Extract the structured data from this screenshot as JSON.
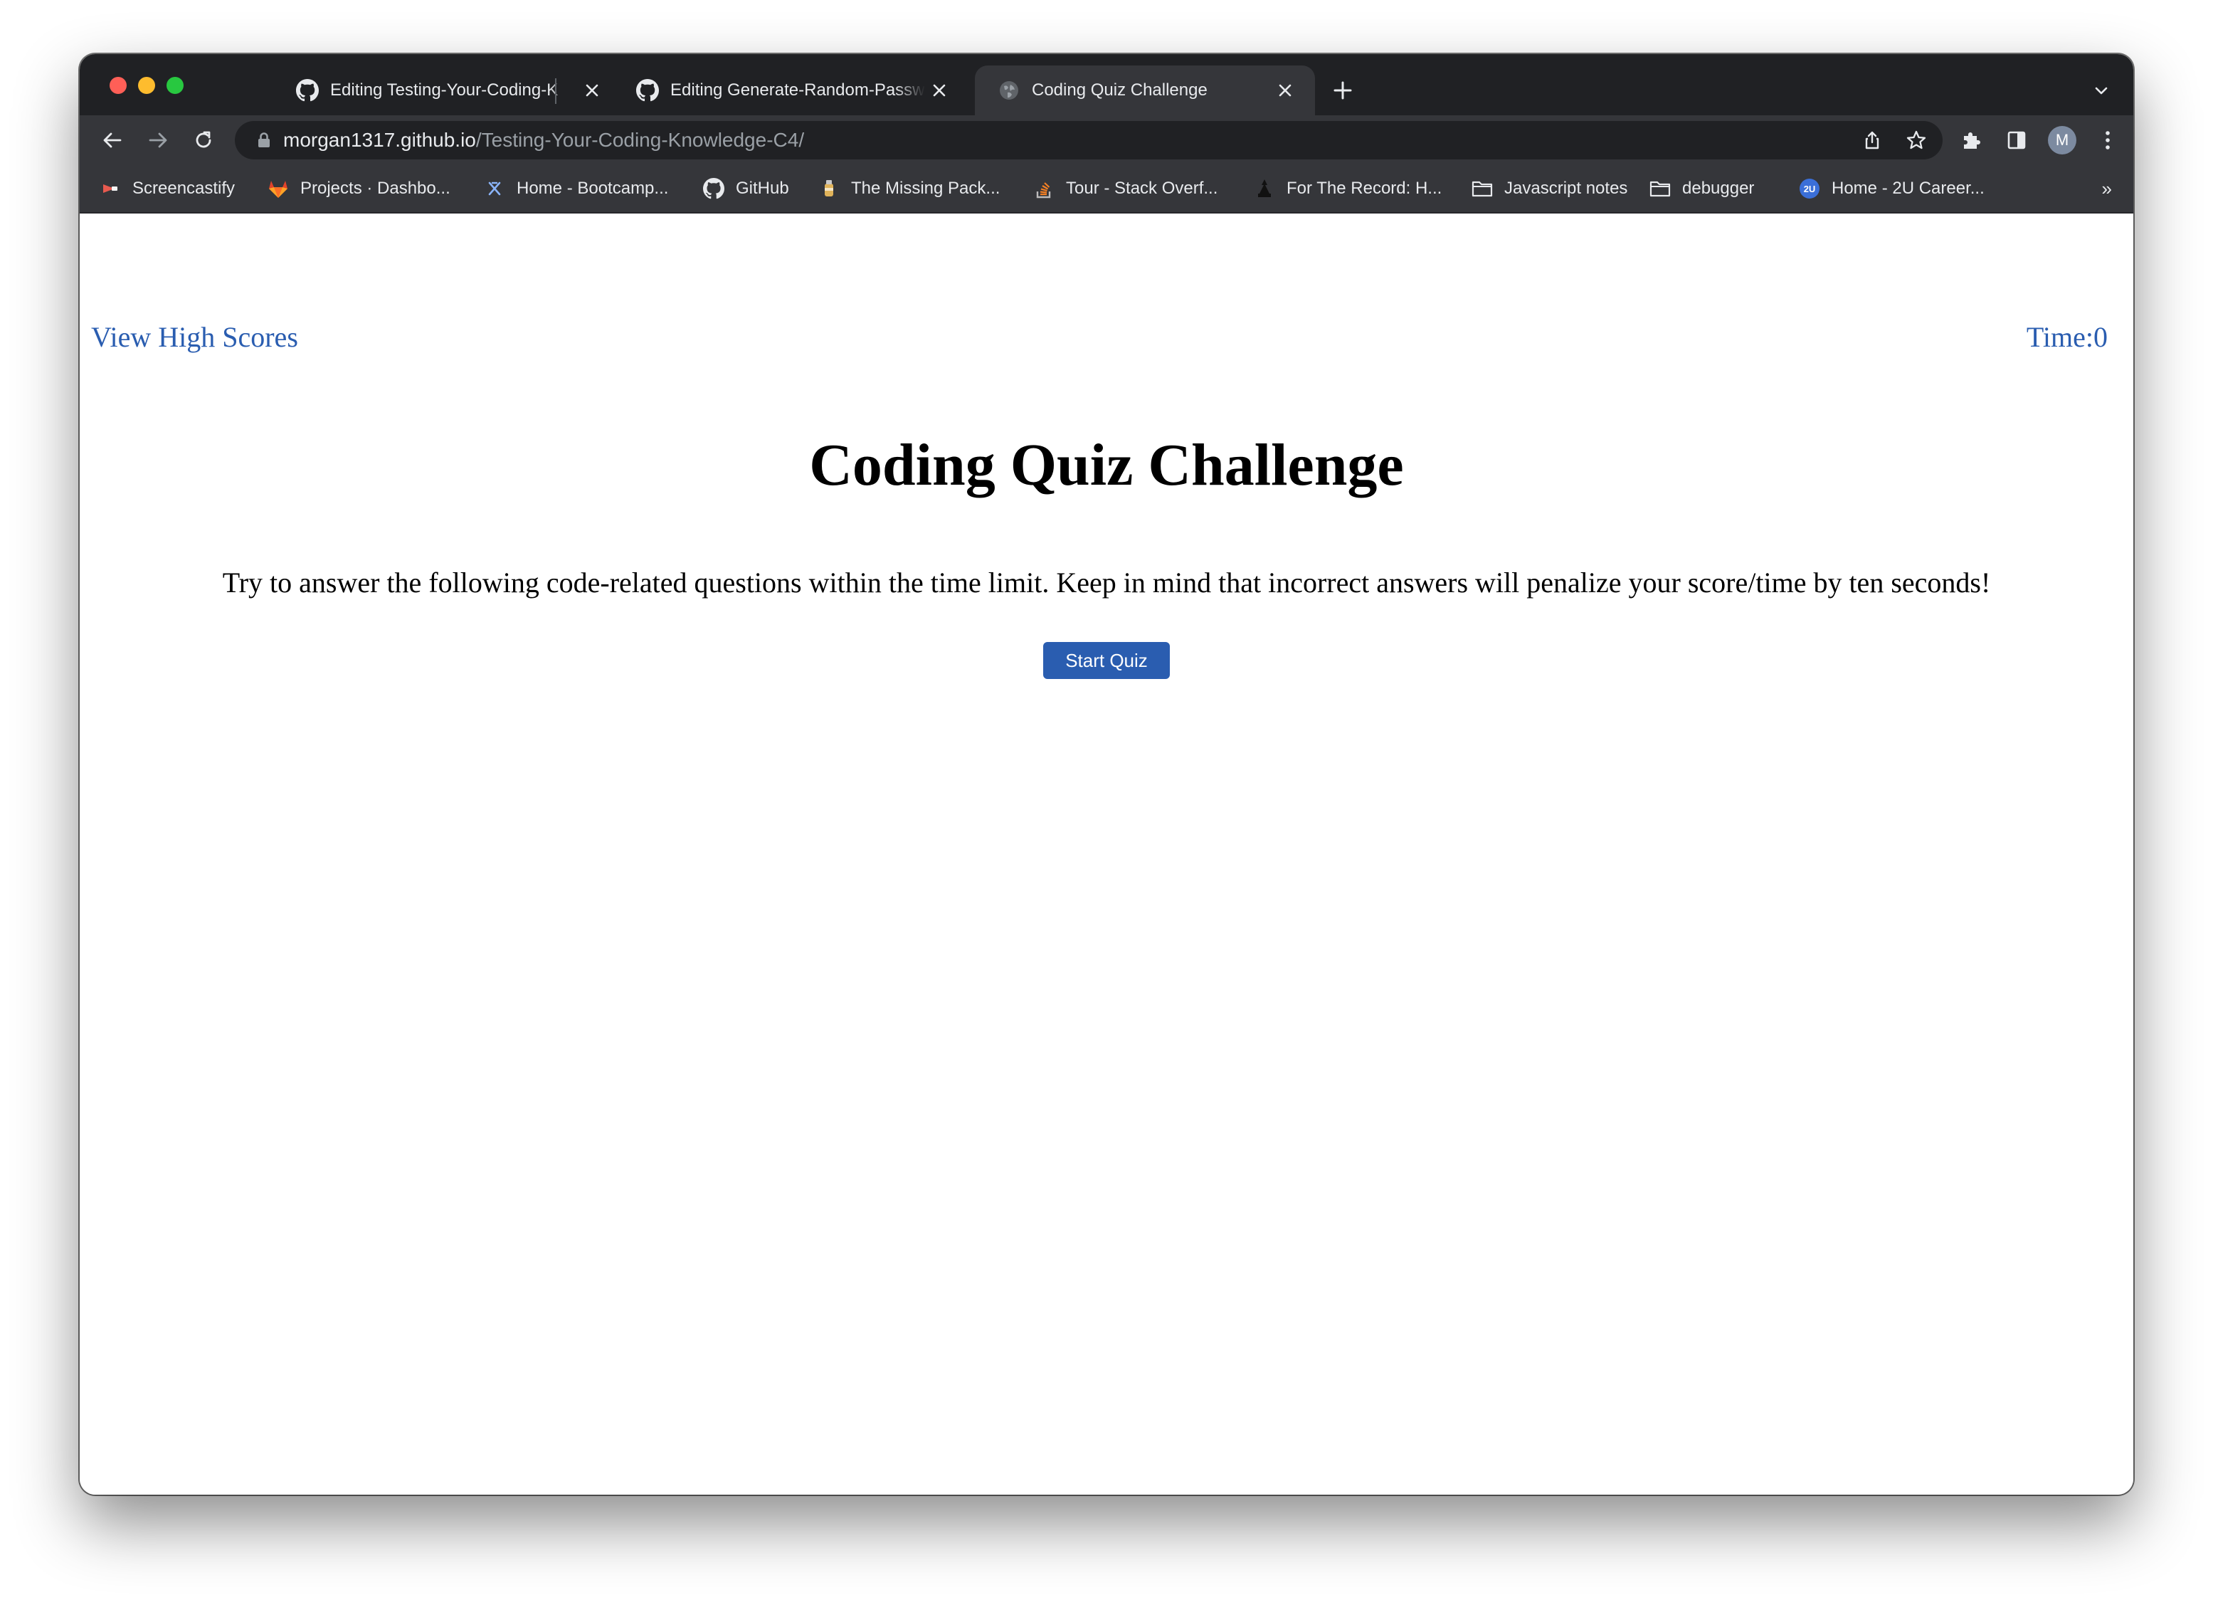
{
  "browser": {
    "tabs": [
      {
        "title": "Editing Testing-Your-Coding-K",
        "icon": "github-icon",
        "active": false
      },
      {
        "title": "Editing Generate-Random-Passwo",
        "icon": "github-icon",
        "active": false
      },
      {
        "title": "Coding Quiz Challenge",
        "icon": "globe-icon",
        "active": true
      }
    ],
    "url": {
      "host": "morgan1317.github.io",
      "path": "/Testing-Your-Coding-Knowledge-C4/"
    },
    "profile_initial": "M",
    "bookmarks": [
      {
        "label": "Screencastify",
        "icon": "screencastify-icon"
      },
      {
        "label": "Projects · Dashbo...",
        "icon": "gitlab-icon"
      },
      {
        "label": "Home - Bootcamp...",
        "icon": "bootcamp-icon"
      },
      {
        "label": "GitHub",
        "icon": "github-icon"
      },
      {
        "label": "The Missing Pack...",
        "icon": "package-icon"
      },
      {
        "label": "Tour - Stack Overf...",
        "icon": "stackoverflow-icon"
      },
      {
        "label": "For The Record: H...",
        "icon": "record-icon"
      },
      {
        "label": "Javascript notes",
        "icon": "folder-icon"
      },
      {
        "label": "debugger",
        "icon": "folder-icon"
      },
      {
        "label": "Home - 2U Career...",
        "icon": "2u-icon"
      }
    ],
    "bookmarks_more": "»"
  },
  "page": {
    "view_high_scores": "View High Scores",
    "timer": "Time:0",
    "title": "Coding Quiz Challenge",
    "description": "Try to answer the following code-related questions within the time limit. Keep in mind that incorrect answers will penalize your score/time by ten seconds!",
    "start_button": "Start Quiz"
  },
  "colors": {
    "link": "#2a5db0",
    "button": "#2a5db0",
    "chrome_dark": "#202124",
    "chrome_toolbar": "#35363a"
  }
}
